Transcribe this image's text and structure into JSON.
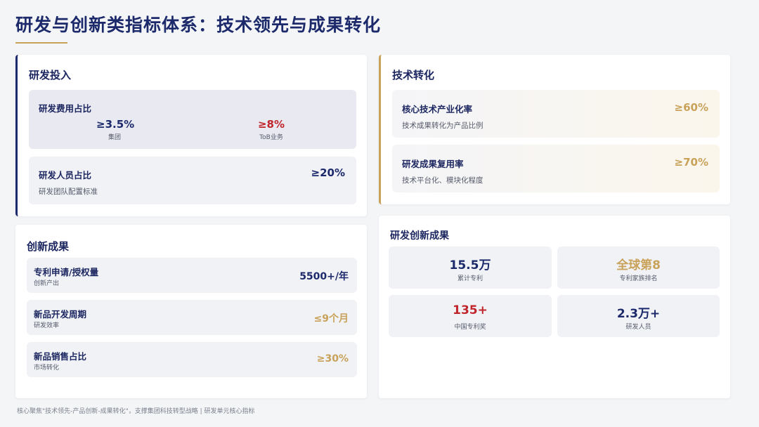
{
  "page": {
    "title": "研发与创新类指标体系：技术领先与成果转化",
    "footnote": "核心聚焦\"技术领先-产品创新-成果转化\"，支撑集团科技转型战略 | 研发单元核心指标"
  },
  "rd_investment": {
    "title": "研发投入",
    "expense_ratio": {
      "title": "研发费用占比",
      "group_value": "≥3.5%",
      "group_label": "集团",
      "tob_value": "≥8%",
      "tob_label": "ToB业务"
    },
    "staff_ratio": {
      "title": "研发人员占比",
      "value": "≥20%",
      "sub": "研发团队配置标准"
    }
  },
  "tech_conversion": {
    "title": "技术转化",
    "items": [
      {
        "title": "核心技术产业化率",
        "value": "≥60%",
        "sub": "技术成果转化为产品比例"
      },
      {
        "title": "研发成果复用率",
        "value": "≥70%",
        "sub": "技术平台化、模块化程度"
      }
    ]
  },
  "innovation_results": {
    "title": "创新成果",
    "items": [
      {
        "title": "专利申请/授权量",
        "sub": "创新产出",
        "value": "5500+/年"
      },
      {
        "title": "新品开发周期",
        "sub": "研发效率",
        "value": "≤9个月"
      },
      {
        "title": "新品销售占比",
        "sub": "市场转化",
        "value": "≥30%"
      }
    ]
  },
  "rd_achievements": {
    "title": "研发创新成果",
    "stats": [
      {
        "value": "15.5万",
        "label": "累计专利"
      },
      {
        "value": "全球第8",
        "label": "专利家族排名"
      },
      {
        "value": "135+",
        "label": "中国专利奖"
      },
      {
        "value": "2.3万+",
        "label": "研发人员"
      }
    ]
  },
  "colors": {
    "navy": "#1c2a6b",
    "red": "#c0252b",
    "gold": "#c9a25a",
    "background": "#f4f5f7"
  }
}
